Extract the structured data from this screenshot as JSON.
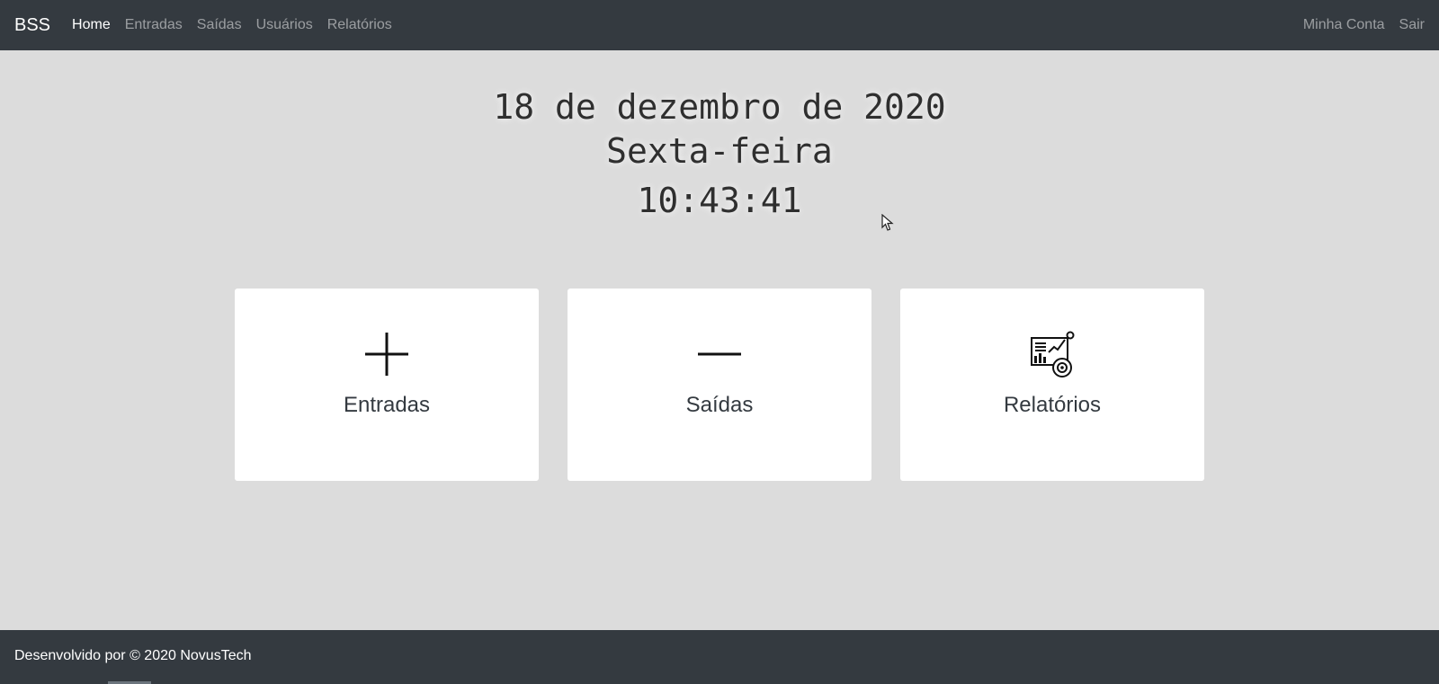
{
  "navbar": {
    "brand": "BSS",
    "links": [
      {
        "label": "Home",
        "active": true
      },
      {
        "label": "Entradas",
        "active": false
      },
      {
        "label": "Saídas",
        "active": false
      },
      {
        "label": "Usuários",
        "active": false
      },
      {
        "label": "Relatórios",
        "active": false
      }
    ],
    "right": {
      "account": "Minha Conta",
      "logout": "Sair"
    }
  },
  "clock": {
    "date": "18 de dezembro de 2020",
    "weekday": "Sexta-feira",
    "time": "10:43:41"
  },
  "cards": [
    {
      "label": "Entradas",
      "icon": "plus-icon"
    },
    {
      "label": "Saídas",
      "icon": "minus-icon"
    },
    {
      "label": "Relatórios",
      "icon": "report-chart-icon"
    }
  ],
  "footer": {
    "text": "Desenvolvido por © 2020 NovusTech"
  },
  "colors": {
    "navbar": "#343a40",
    "background": "#dcdcdc",
    "card": "#ffffff"
  }
}
